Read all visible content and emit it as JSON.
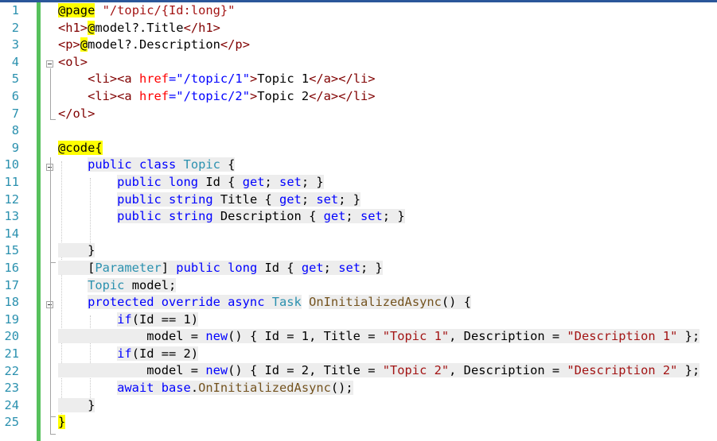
{
  "editor": {
    "colors": {
      "razor_highlight": "#ffff00",
      "razor_background": "#ededed",
      "change_margin": "#57c15c",
      "line_number": "#2b91af",
      "keyword": "#0000ff",
      "type": "#2b91af",
      "string": "#a31515",
      "html_tag": "#800000",
      "html_attribute": "#ff0000",
      "method": "#74531f"
    },
    "lines": [
      {
        "n": "1",
        "tokens": [
          {
            "t": "@page",
            "c": "razor"
          },
          {
            "t": " ",
            "c": "txt"
          },
          {
            "t": "\"/topic/{Id:long}\"",
            "c": "str"
          }
        ]
      },
      {
        "n": "2",
        "tokens": [
          {
            "t": "<h1>",
            "c": "tag"
          },
          {
            "t": "@",
            "c": "razor"
          },
          {
            "t": "model?.Title",
            "c": "txt"
          },
          {
            "t": "</h1>",
            "c": "tag"
          }
        ]
      },
      {
        "n": "3",
        "tokens": [
          {
            "t": "<p>",
            "c": "tag"
          },
          {
            "t": "@",
            "c": "razor"
          },
          {
            "t": "model?.Description",
            "c": "txt"
          },
          {
            "t": "</p>",
            "c": "tag"
          }
        ]
      },
      {
        "n": "4",
        "tokens": [
          {
            "t": "<ol>",
            "c": "tag"
          }
        ]
      },
      {
        "n": "5",
        "tokens": [
          {
            "t": "    ",
            "c": "txt"
          },
          {
            "t": "<li><a ",
            "c": "tag"
          },
          {
            "t": "href",
            "c": "attr"
          },
          {
            "t": "=\"/topic/1\"",
            "c": "kw"
          },
          {
            "t": ">",
            "c": "tag"
          },
          {
            "t": "Topic 1",
            "c": "txt"
          },
          {
            "t": "</a></li>",
            "c": "tag"
          }
        ]
      },
      {
        "n": "6",
        "tokens": [
          {
            "t": "    ",
            "c": "txt"
          },
          {
            "t": "<li><a ",
            "c": "tag"
          },
          {
            "t": "href",
            "c": "attr"
          },
          {
            "t": "=\"/topic/2\"",
            "c": "kw"
          },
          {
            "t": ">",
            "c": "tag"
          },
          {
            "t": "Topic 2",
            "c": "txt"
          },
          {
            "t": "</a></li>",
            "c": "tag"
          }
        ]
      },
      {
        "n": "7",
        "tokens": [
          {
            "t": "</ol>",
            "c": "tag"
          }
        ]
      },
      {
        "n": "8",
        "tokens": []
      },
      {
        "n": "9",
        "tokens": [
          {
            "t": "@code{",
            "c": "razor"
          }
        ]
      },
      {
        "n": "10",
        "tokens": [
          {
            "t": "    ",
            "c": "txt"
          },
          {
            "t": "public class ",
            "c": "kw"
          },
          {
            "t": "Topic",
            "c": "type"
          },
          {
            "t": " {",
            "c": "txt"
          }
        ]
      },
      {
        "n": "11",
        "tokens": [
          {
            "t": "        ",
            "c": "txt"
          },
          {
            "t": "public long ",
            "c": "kw"
          },
          {
            "t": "Id { ",
            "c": "txt"
          },
          {
            "t": "get",
            "c": "kw"
          },
          {
            "t": "; ",
            "c": "txt"
          },
          {
            "t": "set",
            "c": "kw"
          },
          {
            "t": "; }",
            "c": "txt"
          }
        ]
      },
      {
        "n": "12",
        "tokens": [
          {
            "t": "        ",
            "c": "txt"
          },
          {
            "t": "public string ",
            "c": "kw"
          },
          {
            "t": "Title { ",
            "c": "txt"
          },
          {
            "t": "get",
            "c": "kw"
          },
          {
            "t": "; ",
            "c": "txt"
          },
          {
            "t": "set",
            "c": "kw"
          },
          {
            "t": "; }",
            "c": "txt"
          }
        ]
      },
      {
        "n": "13",
        "tokens": [
          {
            "t": "        ",
            "c": "txt"
          },
          {
            "t": "public string ",
            "c": "kw"
          },
          {
            "t": "Description { ",
            "c": "txt"
          },
          {
            "t": "get",
            "c": "kw"
          },
          {
            "t": "; ",
            "c": "txt"
          },
          {
            "t": "set",
            "c": "kw"
          },
          {
            "t": "; }",
            "c": "txt"
          }
        ]
      },
      {
        "n": "14",
        "tokens": []
      },
      {
        "n": "15",
        "tokens": [
          {
            "t": "    }",
            "c": "txt"
          }
        ]
      },
      {
        "n": "16",
        "tokens": [
          {
            "t": "    [",
            "c": "txt"
          },
          {
            "t": "Parameter",
            "c": "type"
          },
          {
            "t": "] ",
            "c": "txt"
          },
          {
            "t": "public long ",
            "c": "kw"
          },
          {
            "t": "Id { ",
            "c": "txt"
          },
          {
            "t": "get",
            "c": "kw"
          },
          {
            "t": "; ",
            "c": "txt"
          },
          {
            "t": "set",
            "c": "kw"
          },
          {
            "t": "; }",
            "c": "txt"
          }
        ]
      },
      {
        "n": "17",
        "tokens": [
          {
            "t": "    ",
            "c": "txt"
          },
          {
            "t": "Topic",
            "c": "type"
          },
          {
            "t": " model;",
            "c": "txt"
          }
        ]
      },
      {
        "n": "18",
        "tokens": [
          {
            "t": "    ",
            "c": "txt"
          },
          {
            "t": "protected override async ",
            "c": "kw"
          },
          {
            "t": "Task",
            "c": "type"
          },
          {
            "t": " ",
            "c": "txt"
          },
          {
            "t": "OnInitializedAsync",
            "c": "fn"
          },
          {
            "t": "() {",
            "c": "txt"
          }
        ]
      },
      {
        "n": "19",
        "tokens": [
          {
            "t": "        ",
            "c": "txt"
          },
          {
            "t": "if",
            "c": "kw"
          },
          {
            "t": "(Id == 1)",
            "c": "txt"
          }
        ]
      },
      {
        "n": "20",
        "tokens": [
          {
            "t": "            model = ",
            "c": "txt"
          },
          {
            "t": "new",
            "c": "kw"
          },
          {
            "t": "() { Id = 1, Title = ",
            "c": "txt"
          },
          {
            "t": "\"Topic 1\"",
            "c": "str"
          },
          {
            "t": ", Description = ",
            "c": "txt"
          },
          {
            "t": "\"Description 1\"",
            "c": "str"
          },
          {
            "t": " };",
            "c": "txt"
          }
        ]
      },
      {
        "n": "21",
        "tokens": [
          {
            "t": "        ",
            "c": "txt"
          },
          {
            "t": "if",
            "c": "kw"
          },
          {
            "t": "(Id == 2)",
            "c": "txt"
          }
        ]
      },
      {
        "n": "22",
        "tokens": [
          {
            "t": "            model = ",
            "c": "txt"
          },
          {
            "t": "new",
            "c": "kw"
          },
          {
            "t": "() { Id = 2, Title = ",
            "c": "txt"
          },
          {
            "t": "\"Topic 2\"",
            "c": "str"
          },
          {
            "t": ", Description = ",
            "c": "txt"
          },
          {
            "t": "\"Description 2\"",
            "c": "str"
          },
          {
            "t": " };",
            "c": "txt"
          }
        ]
      },
      {
        "n": "23",
        "tokens": [
          {
            "t": "        ",
            "c": "txt"
          },
          {
            "t": "await base",
            "c": "kw"
          },
          {
            "t": ".",
            "c": "txt"
          },
          {
            "t": "OnInitializedAsync",
            "c": "fn"
          },
          {
            "t": "();",
            "c": "txt"
          }
        ]
      },
      {
        "n": "24",
        "tokens": [
          {
            "t": "    }",
            "c": "txt"
          }
        ]
      },
      {
        "n": "25",
        "tokens": [
          {
            "t": "}",
            "c": "razor"
          }
        ]
      }
    ]
  }
}
